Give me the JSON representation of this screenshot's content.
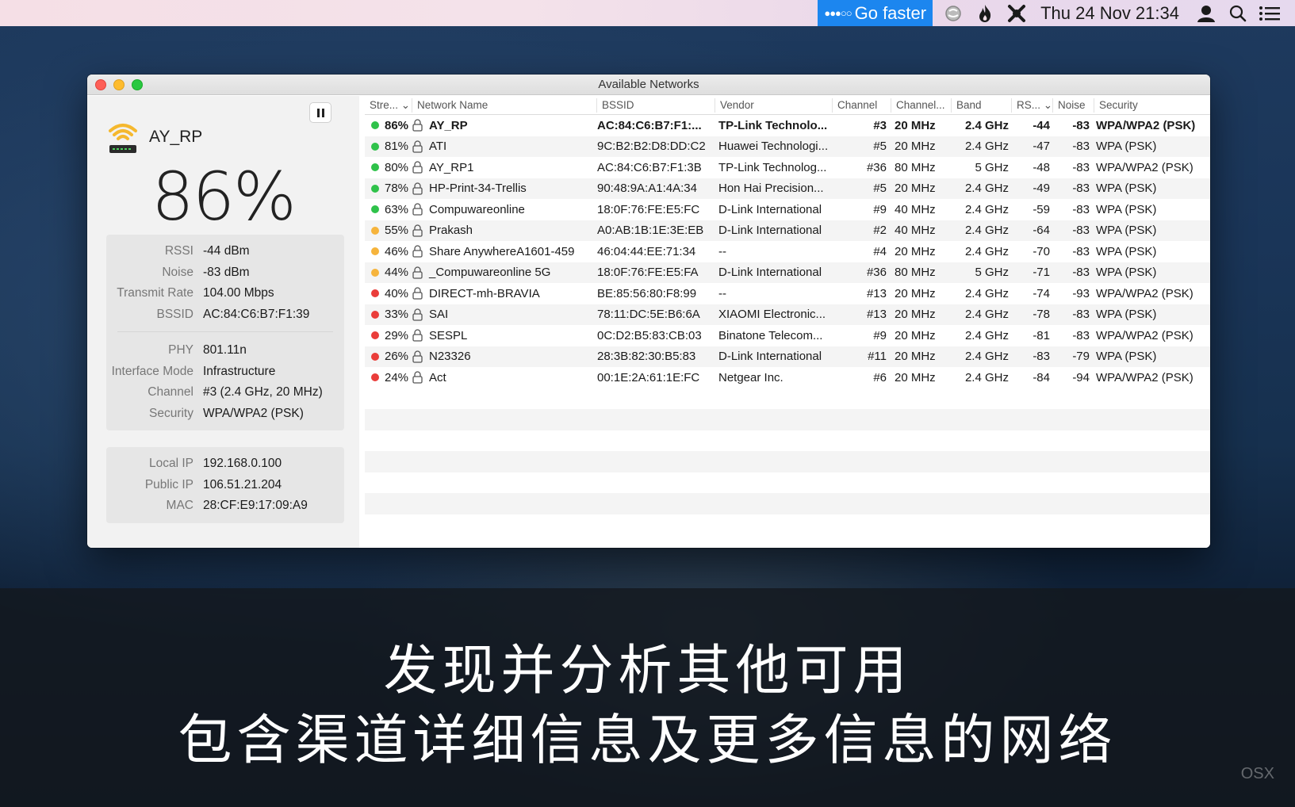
{
  "menubar": {
    "go_faster": "Go faster",
    "go_faster_dots": "●●●○○",
    "clock": "Thu 24 Nov  21:34",
    "icons": [
      "globe-icon",
      "flame-icon",
      "wrench-x-icon",
      "user-icon",
      "search-icon",
      "list-icon"
    ]
  },
  "window": {
    "title": "Available Networks"
  },
  "sidebar": {
    "network_name": "AY_RP",
    "signal_percent": "86%",
    "group1": [
      {
        "k": "RSSI",
        "v": "-44 dBm"
      },
      {
        "k": "Noise",
        "v": "-83 dBm"
      },
      {
        "k": "Transmit Rate",
        "v": "104.00 Mbps"
      },
      {
        "k": "BSSID",
        "v": "AC:84:C6:B7:F1:39"
      }
    ],
    "group2": [
      {
        "k": "PHY",
        "v": "801.11n"
      },
      {
        "k": "Interface Mode",
        "v": "Infrastructure"
      },
      {
        "k": "Channel",
        "v": "#3 (2.4 GHz, 20 MHz)"
      },
      {
        "k": "Security",
        "v": "WPA/WPA2 (PSK)"
      }
    ],
    "group3": [
      {
        "k": "Local IP",
        "v": "192.168.0.100"
      },
      {
        "k": "Public IP",
        "v": "106.51.21.204"
      },
      {
        "k": "MAC",
        "v": "28:CF:E9:17:09:A9"
      }
    ]
  },
  "table": {
    "headers": {
      "strength": "Stre...",
      "name": "Network Name",
      "bssid": "BSSID",
      "vendor": "Vendor",
      "channel": "Channel",
      "channel_width": "Channel...",
      "band": "Band",
      "rssi": "RS...",
      "noise": "Noise",
      "security": "Security"
    },
    "colors": {
      "green": "#2fc24a",
      "orange": "#f6b43c",
      "red": "#ea3d3a"
    },
    "rows": [
      {
        "strength": "86%",
        "level": "green",
        "name": "AY_RP",
        "bssid": "AC:84:C6:B7:F1:...",
        "vendor": "TP-Link Technolo...",
        "channel": "#3",
        "width": "20 MHz",
        "band": "2.4 GHz",
        "rssi": "-44",
        "noise": "-83",
        "security": "WPA/WPA2 (PSK)",
        "selected": true
      },
      {
        "strength": "81%",
        "level": "green",
        "name": "ATI",
        "bssid": "9C:B2:B2:D8:DD:C2",
        "vendor": "Huawei Technologi...",
        "channel": "#5",
        "width": "20 MHz",
        "band": "2.4 GHz",
        "rssi": "-47",
        "noise": "-83",
        "security": "WPA (PSK)"
      },
      {
        "strength": "80%",
        "level": "green",
        "name": "AY_RP1",
        "bssid": "AC:84:C6:B7:F1:3B",
        "vendor": "TP-Link Technolog...",
        "channel": "#36",
        "width": "80 MHz",
        "band": "5 GHz",
        "rssi": "-48",
        "noise": "-83",
        "security": "WPA/WPA2 (PSK)"
      },
      {
        "strength": "78%",
        "level": "green",
        "name": "HP-Print-34-Trellis",
        "bssid": "90:48:9A:A1:4A:34",
        "vendor": "Hon Hai Precision...",
        "channel": "#5",
        "width": "20 MHz",
        "band": "2.4 GHz",
        "rssi": "-49",
        "noise": "-83",
        "security": "WPA (PSK)"
      },
      {
        "strength": "63%",
        "level": "green",
        "name": "Compuwareonline",
        "bssid": "18:0F:76:FE:E5:FC",
        "vendor": "D-Link International",
        "channel": "#9",
        "width": "40 MHz",
        "band": "2.4 GHz",
        "rssi": "-59",
        "noise": "-83",
        "security": "WPA (PSK)"
      },
      {
        "strength": "55%",
        "level": "orange",
        "name": "Prakash",
        "bssid": "A0:AB:1B:1E:3E:EB",
        "vendor": "D-Link International",
        "channel": "#2",
        "width": "40 MHz",
        "band": "2.4 GHz",
        "rssi": "-64",
        "noise": "-83",
        "security": "WPA (PSK)"
      },
      {
        "strength": "46%",
        "level": "orange",
        "name": "Share AnywhereA1601-459",
        "bssid": "46:04:44:EE:71:34",
        "vendor": "--",
        "channel": "#4",
        "width": "20 MHz",
        "band": "2.4 GHz",
        "rssi": "-70",
        "noise": "-83",
        "security": "WPA (PSK)"
      },
      {
        "strength": "44%",
        "level": "orange",
        "name": "_Compuwareonline 5G",
        "bssid": "18:0F:76:FE:E5:FA",
        "vendor": "D-Link International",
        "channel": "#36",
        "width": "80 MHz",
        "band": "5 GHz",
        "rssi": "-71",
        "noise": "-83",
        "security": "WPA (PSK)"
      },
      {
        "strength": "40%",
        "level": "red",
        "name": "DIRECT-mh-BRAVIA",
        "bssid": "BE:85:56:80:F8:99",
        "vendor": "--",
        "channel": "#13",
        "width": "20 MHz",
        "band": "2.4 GHz",
        "rssi": "-74",
        "noise": "-93",
        "security": "WPA/WPA2 (PSK)"
      },
      {
        "strength": "33%",
        "level": "red",
        "name": "SAI",
        "bssid": "78:11:DC:5E:B6:6A",
        "vendor": "XIAOMI Electronic...",
        "channel": "#13",
        "width": "20 MHz",
        "band": "2.4 GHz",
        "rssi": "-78",
        "noise": "-83",
        "security": "WPA (PSK)"
      },
      {
        "strength": "29%",
        "level": "red",
        "name": "SESPL",
        "bssid": "0C:D2:B5:83:CB:03",
        "vendor": "Binatone Telecom...",
        "channel": "#9",
        "width": "20 MHz",
        "band": "2.4 GHz",
        "rssi": "-81",
        "noise": "-83",
        "security": "WPA/WPA2 (PSK)"
      },
      {
        "strength": "26%",
        "level": "red",
        "name": "N23326",
        "bssid": "28:3B:82:30:B5:83",
        "vendor": "D-Link International",
        "channel": "#11",
        "width": "20 MHz",
        "band": "2.4 GHz",
        "rssi": "-83",
        "noise": "-79",
        "security": "WPA (PSK)"
      },
      {
        "strength": "24%",
        "level": "red",
        "name": "Act",
        "bssid": "00:1E:2A:61:1E:FC",
        "vendor": "Netgear Inc.",
        "channel": "#6",
        "width": "20 MHz",
        "band": "2.4 GHz",
        "rssi": "-84",
        "noise": "-94",
        "security": "WPA/WPA2 (PSK)"
      }
    ]
  },
  "caption": {
    "line1": "发现并分析其他可用",
    "line2": "包含渠道详细信息及更多信息的网络"
  },
  "watermark": "OSX"
}
